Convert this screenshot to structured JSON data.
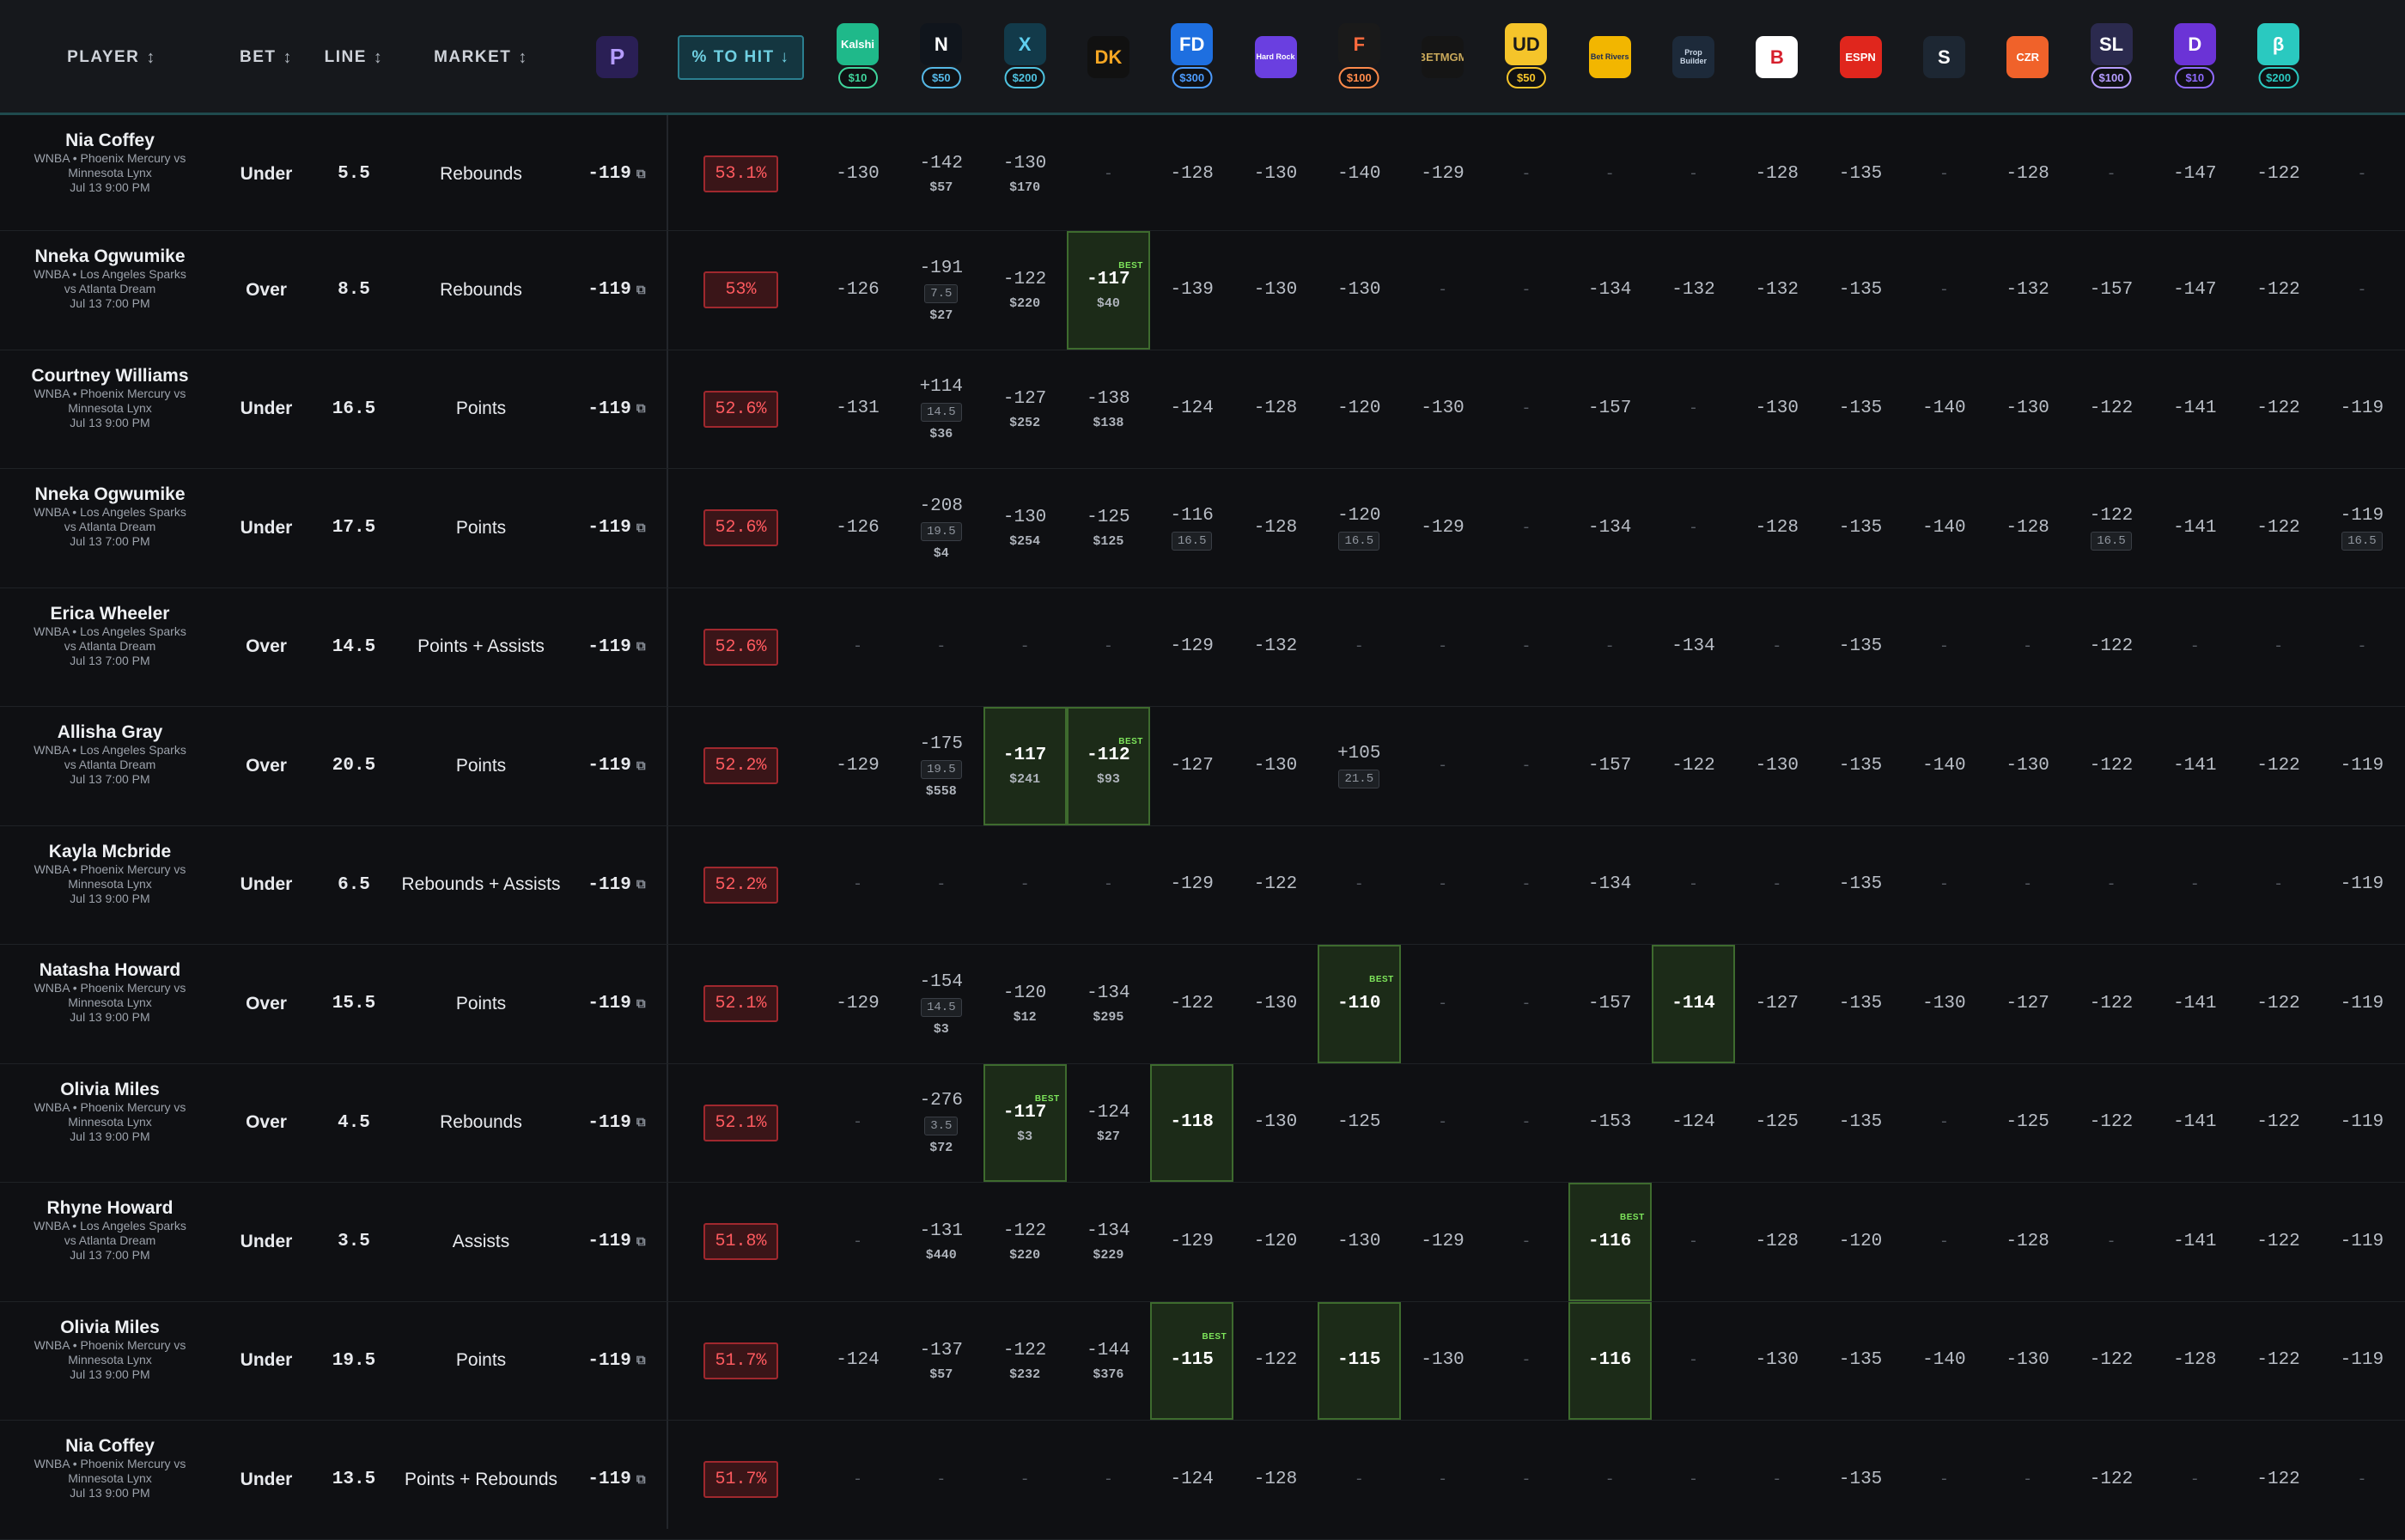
{
  "header": {
    "player": "PLAYER",
    "bet": "BET",
    "line": "LINE",
    "market": "MARKET",
    "sort_glyph": "↕",
    "to_hit": "% TO HIT ↓",
    "books": [
      {
        "icon": "prizepicks-logo-icon",
        "text": "P",
        "bg": "#2a1f55",
        "fg": "#b59cff",
        "stake": ""
      },
      {
        "icon": "kalshi-logo-icon",
        "text": "Kalshi",
        "bg": "#1fb98a",
        "fg": "#ffffff",
        "stake": "$10",
        "stake_color": "#3fd39b"
      },
      {
        "icon": "novig-logo-icon",
        "text": "N",
        "bg": "#10151c",
        "fg": "#ffffff",
        "stake": "$50",
        "stake_color": "#55b8e6"
      },
      {
        "icon": "prophetx-logo-icon",
        "text": "X",
        "bg": "#123a4a",
        "fg": "#5fd0f0",
        "stake": "$200",
        "stake_color": "#4fc3e0"
      },
      {
        "icon": "draftkings-logo-icon",
        "text": "DK",
        "bg": "#111111",
        "fg": "#f5a623",
        "stake": ""
      },
      {
        "icon": "fanduel-logo-icon",
        "text": "FD",
        "bg": "#1e6fe0",
        "fg": "#ffffff",
        "stake": "$300",
        "stake_color": "#4d9cff"
      },
      {
        "icon": "hardrock-logo-icon",
        "text": "Hard Rock",
        "bg": "#6a3fe0",
        "fg": "#ffffff",
        "stake": ""
      },
      {
        "icon": "fanatics-logo-icon",
        "text": "F",
        "bg": "#1a1a1a",
        "fg": "#ff6a3d",
        "stake": "$100",
        "stake_color": "#ff8a4a"
      },
      {
        "icon": "betmgm-logo-icon",
        "text": "BETMGM",
        "bg": "#151515",
        "fg": "#c8a85a",
        "stake": ""
      },
      {
        "icon": "underdog-logo-icon",
        "text": "UD",
        "bg": "#f5c42a",
        "fg": "#1a1a1a",
        "stake": "$50",
        "stake_color": "#f5c42a"
      },
      {
        "icon": "betrivers-logo-icon",
        "text": "Bet Rivers",
        "bg": "#f2b600",
        "fg": "#1a2a55",
        "stake": ""
      },
      {
        "icon": "propbuilder-logo-icon",
        "text": "Prop Builder",
        "bg": "#1d2a3a",
        "fg": "#c9d6e6",
        "stake": ""
      },
      {
        "icon": "betonline-logo-icon",
        "text": "B",
        "bg": "#ffffff",
        "fg": "#d61f2c",
        "stake": ""
      },
      {
        "icon": "espnbet-logo-icon",
        "text": "ESPN",
        "bg": "#e0261d",
        "fg": "#ffffff",
        "stake": ""
      },
      {
        "icon": "sports-logo-icon",
        "text": "S",
        "bg": "#1d2733",
        "fg": "#ffffff",
        "stake": ""
      },
      {
        "icon": "caesars-logo-icon",
        "text": "CZR",
        "bg": "#f0622a",
        "fg": "#ffffff",
        "stake": ""
      },
      {
        "icon": "sleeper-logo-icon",
        "text": "SL",
        "bg": "#2b2a4e",
        "fg": "#ffffff",
        "stake": "$100",
        "stake_color": "#b59cff"
      },
      {
        "icon": "dabble-logo-icon",
        "text": "D",
        "bg": "#6b33d6",
        "fg": "#ffffff",
        "stake": "$10",
        "stake_color": "#8f6bff"
      },
      {
        "icon": "betr-logo-icon",
        "text": "β",
        "bg": "#2ac9c0",
        "fg": "#ffffff",
        "stake": "$200",
        "stake_color": "#2ac9c0"
      }
    ]
  },
  "rows": [
    {
      "name": "Nia Coffey",
      "game": [
        "WNBA • Phoenix Mercury vs",
        "Minnesota Lynx",
        "Jul 13 9:00 PM"
      ],
      "bet": "Under",
      "line": "5.5",
      "market": "Rebounds",
      "own": "-119",
      "pct": "53.1%",
      "books": [
        {
          "o": "-130"
        },
        {
          "o": "-142",
          "s": "$57"
        },
        {
          "o": "-130",
          "s": "$170"
        },
        {
          "o": "-"
        },
        {
          "o": "-128"
        },
        {
          "o": "-130"
        },
        {
          "o": "-140"
        },
        {
          "o": "-129"
        },
        {
          "o": "-"
        },
        {
          "o": "-"
        },
        {
          "o": "-"
        },
        {
          "o": "-128"
        },
        {
          "o": "-135"
        },
        {
          "o": "-"
        },
        {
          "o": "-128"
        },
        {
          "o": "-"
        },
        {
          "o": "-147"
        },
        {
          "o": "-122"
        },
        {
          "o": "-"
        }
      ]
    },
    {
      "name": "Nneka Ogwumike",
      "game": [
        "WNBA • Los Angeles Sparks",
        "vs Atlanta Dream",
        "Jul 13 7:00 PM"
      ],
      "bet": "Over",
      "line": "8.5",
      "market": "Rebounds",
      "own": "-119",
      "pct": "53%",
      "books": [
        {
          "o": "-126"
        },
        {
          "o": "-191",
          "l": "7.5",
          "s": "$27"
        },
        {
          "o": "-122",
          "s": "$220"
        },
        {
          "o": "-117",
          "s": "$40",
          "hl": true,
          "best": true
        },
        {
          "o": "-139"
        },
        {
          "o": "-130"
        },
        {
          "o": "-130"
        },
        {
          "o": "-"
        },
        {
          "o": "-"
        },
        {
          "o": "-134"
        },
        {
          "o": "-132"
        },
        {
          "o": "-132"
        },
        {
          "o": "-135"
        },
        {
          "o": "-"
        },
        {
          "o": "-132"
        },
        {
          "o": "-157"
        },
        {
          "o": "-147"
        },
        {
          "o": "-122"
        },
        {
          "o": "-"
        }
      ]
    },
    {
      "name": "Courtney Williams",
      "game": [
        "WNBA • Phoenix Mercury vs",
        "Minnesota Lynx",
        "Jul 13 9:00 PM"
      ],
      "bet": "Under",
      "line": "16.5",
      "market": "Points",
      "own": "-119",
      "pct": "52.6%",
      "books": [
        {
          "o": "-131"
        },
        {
          "o": "+114",
          "l": "14.5",
          "s": "$36"
        },
        {
          "o": "-127",
          "s": "$252"
        },
        {
          "o": "-138",
          "s": "$138"
        },
        {
          "o": "-124"
        },
        {
          "o": "-128"
        },
        {
          "o": "-120"
        },
        {
          "o": "-130"
        },
        {
          "o": "-"
        },
        {
          "o": "-157"
        },
        {
          "o": "-"
        },
        {
          "o": "-130"
        },
        {
          "o": "-135"
        },
        {
          "o": "-140"
        },
        {
          "o": "-130"
        },
        {
          "o": "-122"
        },
        {
          "o": "-141"
        },
        {
          "o": "-122"
        },
        {
          "o": "-119"
        }
      ]
    },
    {
      "name": "Nneka Ogwumike",
      "game": [
        "WNBA • Los Angeles Sparks",
        "vs Atlanta Dream",
        "Jul 13 7:00 PM"
      ],
      "bet": "Under",
      "line": "17.5",
      "market": "Points",
      "own": "-119",
      "pct": "52.6%",
      "books": [
        {
          "o": "-126"
        },
        {
          "o": "-208",
          "l": "19.5",
          "s": "$4"
        },
        {
          "o": "-130",
          "s": "$254"
        },
        {
          "o": "-125",
          "s": "$125"
        },
        {
          "o": "-116",
          "l": "16.5"
        },
        {
          "o": "-128"
        },
        {
          "o": "-120",
          "l": "16.5"
        },
        {
          "o": "-129"
        },
        {
          "o": "-"
        },
        {
          "o": "-134"
        },
        {
          "o": "-"
        },
        {
          "o": "-128"
        },
        {
          "o": "-135"
        },
        {
          "o": "-140"
        },
        {
          "o": "-128"
        },
        {
          "o": "-122",
          "l": "16.5"
        },
        {
          "o": "-141"
        },
        {
          "o": "-122"
        },
        {
          "o": "-119",
          "l": "16.5"
        }
      ]
    },
    {
      "name": "Erica Wheeler",
      "game": [
        "WNBA • Los Angeles Sparks",
        "vs Atlanta Dream",
        "Jul 13 7:00 PM"
      ],
      "bet": "Over",
      "line": "14.5",
      "market": "Points + Assists",
      "own": "-119",
      "pct": "52.6%",
      "books": [
        {
          "o": "-"
        },
        {
          "o": "-"
        },
        {
          "o": "-"
        },
        {
          "o": "-"
        },
        {
          "o": "-129"
        },
        {
          "o": "-132"
        },
        {
          "o": "-"
        },
        {
          "o": "-"
        },
        {
          "o": "-"
        },
        {
          "o": "-"
        },
        {
          "o": "-134"
        },
        {
          "o": "-"
        },
        {
          "o": "-135"
        },
        {
          "o": "-"
        },
        {
          "o": "-"
        },
        {
          "o": "-122"
        },
        {
          "o": "-"
        },
        {
          "o": "-"
        },
        {
          "o": "-"
        }
      ]
    },
    {
      "name": "Allisha Gray",
      "game": [
        "WNBA • Los Angeles Sparks",
        "vs Atlanta Dream",
        "Jul 13 7:00 PM"
      ],
      "bet": "Over",
      "line": "20.5",
      "market": "Points",
      "own": "-119",
      "pct": "52.2%",
      "books": [
        {
          "o": "-129"
        },
        {
          "o": "-175",
          "l": "19.5",
          "s": "$558"
        },
        {
          "o": "-117",
          "s": "$241",
          "hl": true
        },
        {
          "o": "-112",
          "s": "$93",
          "hl": true,
          "best": true
        },
        {
          "o": "-127"
        },
        {
          "o": "-130"
        },
        {
          "o": "+105",
          "l": "21.5"
        },
        {
          "o": "-"
        },
        {
          "o": "-"
        },
        {
          "o": "-157"
        },
        {
          "o": "-122"
        },
        {
          "o": "-130"
        },
        {
          "o": "-135"
        },
        {
          "o": "-140"
        },
        {
          "o": "-130"
        },
        {
          "o": "-122"
        },
        {
          "o": "-141"
        },
        {
          "o": "-122"
        },
        {
          "o": "-119"
        }
      ]
    },
    {
      "name": "Kayla Mcbride",
      "game": [
        "WNBA • Phoenix Mercury vs",
        "Minnesota Lynx",
        "Jul 13 9:00 PM"
      ],
      "bet": "Under",
      "line": "6.5",
      "market": "Rebounds + Assists",
      "own": "-119",
      "pct": "52.2%",
      "books": [
        {
          "o": "-"
        },
        {
          "o": "-"
        },
        {
          "o": "-"
        },
        {
          "o": "-"
        },
        {
          "o": "-129"
        },
        {
          "o": "-122"
        },
        {
          "o": "-"
        },
        {
          "o": "-"
        },
        {
          "o": "-"
        },
        {
          "o": "-134"
        },
        {
          "o": "-"
        },
        {
          "o": "-"
        },
        {
          "o": "-135"
        },
        {
          "o": "-"
        },
        {
          "o": "-"
        },
        {
          "o": "-"
        },
        {
          "o": "-"
        },
        {
          "o": "-"
        },
        {
          "o": "-119"
        }
      ]
    },
    {
      "name": "Natasha Howard",
      "game": [
        "WNBA • Phoenix Mercury vs",
        "Minnesota Lynx",
        "Jul 13 9:00 PM"
      ],
      "bet": "Over",
      "line": "15.5",
      "market": "Points",
      "own": "-119",
      "pct": "52.1%",
      "books": [
        {
          "o": "-129"
        },
        {
          "o": "-154",
          "l": "14.5",
          "s": "$3"
        },
        {
          "o": "-120",
          "s": "$12"
        },
        {
          "o": "-134",
          "s": "$295"
        },
        {
          "o": "-122"
        },
        {
          "o": "-130"
        },
        {
          "o": "-110",
          "hl": true,
          "best": true
        },
        {
          "o": "-"
        },
        {
          "o": "-"
        },
        {
          "o": "-157"
        },
        {
          "o": "-114",
          "hl": true
        },
        {
          "o": "-127"
        },
        {
          "o": "-135"
        },
        {
          "o": "-130"
        },
        {
          "o": "-127"
        },
        {
          "o": "-122"
        },
        {
          "o": "-141"
        },
        {
          "o": "-122"
        },
        {
          "o": "-119"
        }
      ]
    },
    {
      "name": "Olivia Miles",
      "game": [
        "WNBA • Phoenix Mercury vs",
        "Minnesota Lynx",
        "Jul 13 9:00 PM"
      ],
      "bet": "Over",
      "line": "4.5",
      "market": "Rebounds",
      "own": "-119",
      "pct": "52.1%",
      "books": [
        {
          "o": "-"
        },
        {
          "o": "-276",
          "l": "3.5",
          "s": "$72"
        },
        {
          "o": "-117",
          "s": "$3",
          "hl": true,
          "best": true
        },
        {
          "o": "-124",
          "s": "$27"
        },
        {
          "o": "-118",
          "hl": true
        },
        {
          "o": "-130"
        },
        {
          "o": "-125"
        },
        {
          "o": "-"
        },
        {
          "o": "-"
        },
        {
          "o": "-153"
        },
        {
          "o": "-124"
        },
        {
          "o": "-125"
        },
        {
          "o": "-135"
        },
        {
          "o": "-"
        },
        {
          "o": "-125"
        },
        {
          "o": "-122"
        },
        {
          "o": "-141"
        },
        {
          "o": "-122"
        },
        {
          "o": "-119"
        }
      ]
    },
    {
      "name": "Rhyne Howard",
      "game": [
        "WNBA • Los Angeles Sparks",
        "vs Atlanta Dream",
        "Jul 13 7:00 PM"
      ],
      "bet": "Under",
      "line": "3.5",
      "market": "Assists",
      "own": "-119",
      "pct": "51.8%",
      "books": [
        {
          "o": "-"
        },
        {
          "o": "-131",
          "s": "$440"
        },
        {
          "o": "-122",
          "s": "$220"
        },
        {
          "o": "-134",
          "s": "$229"
        },
        {
          "o": "-129"
        },
        {
          "o": "-120"
        },
        {
          "o": "-130"
        },
        {
          "o": "-129"
        },
        {
          "o": "-"
        },
        {
          "o": "-116",
          "hl": true,
          "best": true
        },
        {
          "o": "-"
        },
        {
          "o": "-128"
        },
        {
          "o": "-120"
        },
        {
          "o": "-"
        },
        {
          "o": "-128"
        },
        {
          "o": "-"
        },
        {
          "o": "-141"
        },
        {
          "o": "-122"
        },
        {
          "o": "-119"
        }
      ]
    },
    {
      "name": "Olivia Miles",
      "game": [
        "WNBA • Phoenix Mercury vs",
        "Minnesota Lynx",
        "Jul 13 9:00 PM"
      ],
      "bet": "Under",
      "line": "19.5",
      "market": "Points",
      "own": "-119",
      "pct": "51.7%",
      "books": [
        {
          "o": "-124"
        },
        {
          "o": "-137",
          "s": "$57"
        },
        {
          "o": "-122",
          "s": "$232"
        },
        {
          "o": "-144",
          "s": "$376"
        },
        {
          "o": "-115",
          "hl": true,
          "best": true
        },
        {
          "o": "-122"
        },
        {
          "o": "-115",
          "hl": true
        },
        {
          "o": "-130"
        },
        {
          "o": "-"
        },
        {
          "o": "-116",
          "hl": true
        },
        {
          "o": "-"
        },
        {
          "o": "-130"
        },
        {
          "o": "-135"
        },
        {
          "o": "-140"
        },
        {
          "o": "-130"
        },
        {
          "o": "-122"
        },
        {
          "o": "-128"
        },
        {
          "o": "-122"
        },
        {
          "o": "-119"
        }
      ]
    },
    {
      "name": "Nia Coffey",
      "game": [
        "WNBA • Phoenix Mercury vs",
        "Minnesota Lynx",
        "Jul 13 9:00 PM"
      ],
      "bet": "Under",
      "line": "13.5",
      "market": "Points + Rebounds",
      "own": "-119",
      "pct": "51.7%",
      "books": [
        {
          "o": "-"
        },
        {
          "o": "-"
        },
        {
          "o": "-"
        },
        {
          "o": "-"
        },
        {
          "o": "-124"
        },
        {
          "o": "-128"
        },
        {
          "o": "-"
        },
        {
          "o": "-"
        },
        {
          "o": "-"
        },
        {
          "o": "-"
        },
        {
          "o": "-"
        },
        {
          "o": "-"
        },
        {
          "o": "-135"
        },
        {
          "o": "-"
        },
        {
          "o": "-"
        },
        {
          "o": "-122"
        },
        {
          "o": "-"
        },
        {
          "o": "-122"
        },
        {
          "o": "-"
        }
      ]
    }
  ],
  "best_label": "BEST",
  "external_link_glyph": "⧉"
}
